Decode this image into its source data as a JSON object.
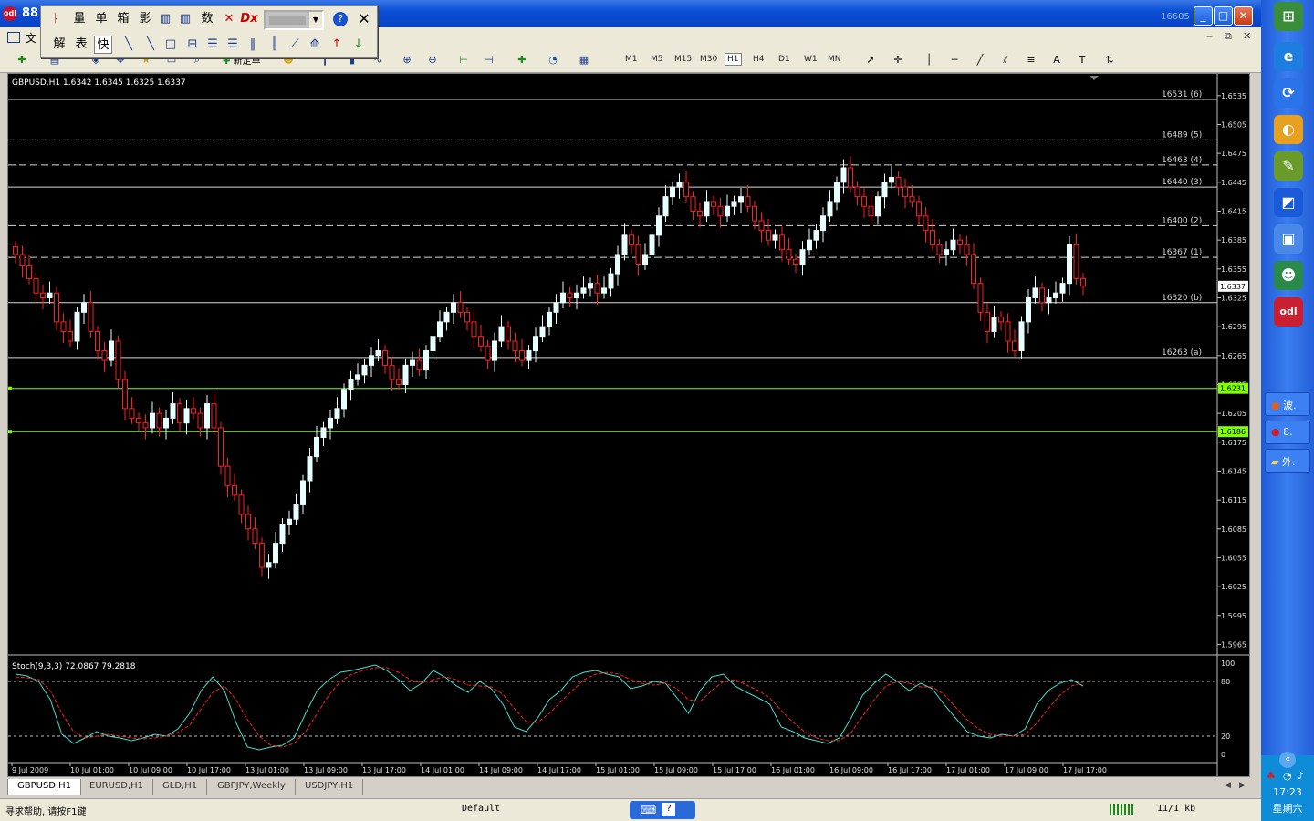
{
  "window": {
    "title": "88",
    "right_label": "16605"
  },
  "menu": {
    "first_label": "文"
  },
  "float_toolbar": {
    "row1": [
      "量",
      "单",
      "箱",
      "影",
      "数"
    ],
    "row2": [
      "解",
      "表",
      "快"
    ]
  },
  "toolbar": {
    "new_order_label": "新定单",
    "timeframes": [
      "M1",
      "M5",
      "M15",
      "M30",
      "H1",
      "H4",
      "D1",
      "W1",
      "MN"
    ],
    "active_timeframe": "H1"
  },
  "chart": {
    "symbol_info": "GBPUSD,H1  1.6342 1.6345 1.6325 1.6337",
    "price_labels": [
      "1.6535",
      "1.6505",
      "1.6475",
      "1.6445",
      "1.6415",
      "1.6385",
      "1.6355",
      "1.6325",
      "1.6295",
      "1.6265",
      "1.6235",
      "1.6205",
      "1.6175",
      "1.6145",
      "1.6115",
      "1.6085",
      "1.6055",
      "1.6025",
      "1.5995",
      "1.5965"
    ],
    "current_price": "1.6337",
    "green_lines": [
      "1.6231",
      "1.6186"
    ],
    "levels": [
      {
        "label": "16531 (6)",
        "price": 1.6531,
        "style": "solid"
      },
      {
        "label": "16489 (5)",
        "price": 1.6489,
        "style": "dashed"
      },
      {
        "label": "16463 (4)",
        "price": 1.6463,
        "style": "dashed"
      },
      {
        "label": "16440 (3)",
        "price": 1.644,
        "style": "solid"
      },
      {
        "label": "16400 (2)",
        "price": 1.64,
        "style": "dashed"
      },
      {
        "label": "16367 (1)",
        "price": 1.6367,
        "style": "dashed"
      },
      {
        "label": "16320 (b)",
        "price": 1.632,
        "style": "solid"
      },
      {
        "label": "16263 (a)",
        "price": 1.6263,
        "style": "solid"
      }
    ],
    "time_labels": [
      "9 Jul 2009",
      "10 Jul 01:00",
      "10 Jul 09:00",
      "10 Jul 17:00",
      "13 Jul 01:00",
      "13 Jul 09:00",
      "13 Jul 17:00",
      "14 Jul 01:00",
      "14 Jul 09:00",
      "14 Jul 17:00",
      "15 Jul 01:00",
      "15 Jul 09:00",
      "15 Jul 17:00",
      "16 Jul 01:00",
      "16 Jul 09:00",
      "16 Jul 17:00",
      "17 Jul 01:00",
      "17 Jul 09:00",
      "17 Jul 17:00"
    ],
    "stoch_label": "Stoch(9,3,3) 72.0867 79.2818",
    "stoch_scale": [
      "100",
      "80",
      "20",
      "0"
    ]
  },
  "chart_data": {
    "type": "candlestick",
    "title": "GBPUSD,H1",
    "ylim": [
      1.5955,
      1.655
    ],
    "closes": [
      1.637,
      1.6358,
      1.6345,
      1.633,
      1.6325,
      1.633,
      1.63,
      1.629,
      1.628,
      1.631,
      1.632,
      1.629,
      1.627,
      1.626,
      1.628,
      1.624,
      1.621,
      1.62,
      1.6195,
      1.619,
      1.6205,
      1.619,
      1.62,
      1.6215,
      1.6195,
      1.621,
      1.6205,
      1.619,
      1.6215,
      1.619,
      1.615,
      1.613,
      1.612,
      1.61,
      1.6085,
      1.607,
      1.6045,
      1.605,
      1.607,
      1.609,
      1.6095,
      1.611,
      1.6135,
      1.616,
      1.618,
      1.619,
      1.62,
      1.621,
      1.623,
      1.624,
      1.6245,
      1.6255,
      1.6265,
      1.627,
      1.6255,
      1.624,
      1.6235,
      1.6255,
      1.626,
      1.625,
      1.627,
      1.6285,
      1.63,
      1.631,
      1.632,
      1.631,
      1.63,
      1.6285,
      1.6275,
      1.626,
      1.628,
      1.6295,
      1.628,
      1.627,
      1.626,
      1.627,
      1.6285,
      1.6295,
      1.631,
      1.632,
      1.633,
      1.6325,
      1.633,
      1.6335,
      1.634,
      1.633,
      1.6335,
      1.635,
      1.637,
      1.639,
      1.638,
      1.636,
      1.637,
      1.639,
      1.641,
      1.643,
      1.644,
      1.6445,
      1.643,
      1.6415,
      1.641,
      1.6425,
      1.642,
      1.641,
      1.642,
      1.6425,
      1.643,
      1.642,
      1.6405,
      1.6395,
      1.6385,
      1.639,
      1.6375,
      1.6365,
      1.636,
      1.6375,
      1.6385,
      1.6395,
      1.641,
      1.6425,
      1.6445,
      1.646,
      1.644,
      1.643,
      1.642,
      1.641,
      1.643,
      1.6445,
      1.645,
      1.644,
      1.643,
      1.6425,
      1.641,
      1.6395,
      1.638,
      1.637,
      1.6375,
      1.6385,
      1.638,
      1.637,
      1.634,
      1.631,
      1.629,
      1.6305,
      1.63,
      1.628,
      1.627,
      1.63,
      1.6325,
      1.6335,
      1.632,
      1.6325,
      1.633,
      1.634,
      1.638,
      1.6345,
      1.6337
    ],
    "stoch_k": [
      88,
      86,
      80,
      60,
      22,
      12,
      18,
      25,
      20,
      18,
      15,
      18,
      22,
      20,
      28,
      45,
      70,
      85,
      70,
      35,
      8,
      5,
      8,
      10,
      18,
      45,
      70,
      82,
      90,
      92,
      95,
      98,
      92,
      82,
      70,
      78,
      92,
      85,
      75,
      68,
      80,
      72,
      55,
      30,
      25,
      40,
      60,
      70,
      85,
      90,
      92,
      88,
      85,
      72,
      75,
      80,
      78,
      62,
      45,
      70,
      85,
      88,
      75,
      68,
      62,
      55,
      30,
      25,
      18,
      15,
      12,
      18,
      40,
      65,
      78,
      88,
      80,
      70,
      78,
      72,
      55,
      40,
      25,
      20,
      18,
      22,
      20,
      28,
      55,
      70,
      78,
      82,
      75
    ],
    "stoch_d": [
      85,
      84,
      82,
      70,
      45,
      25,
      18,
      20,
      22,
      20,
      18,
      17,
      18,
      20,
      24,
      32,
      50,
      68,
      75,
      60,
      38,
      20,
      10,
      8,
      12,
      25,
      45,
      65,
      80,
      88,
      92,
      95,
      95,
      90,
      82,
      78,
      82,
      85,
      82,
      76,
      75,
      74,
      66,
      50,
      36,
      35,
      45,
      58,
      70,
      82,
      88,
      90,
      88,
      82,
      78,
      76,
      78,
      72,
      60,
      58,
      70,
      80,
      82,
      76,
      70,
      62,
      48,
      35,
      25,
      18,
      15,
      15,
      24,
      42,
      60,
      75,
      80,
      78,
      74,
      74,
      66,
      52,
      38,
      28,
      22,
      20,
      20,
      22,
      34,
      50,
      65,
      75,
      79
    ]
  },
  "tabs": [
    "GBPUSD,H1",
    "EURUSD,H1",
    "GLD,H1",
    "GBPJPY,Weekly",
    "USDJPY,H1"
  ],
  "status": {
    "help": "寻求帮助, 请按F1键",
    "profile": "Default",
    "traffic": "11/1 kb"
  },
  "taskbar": {
    "items": [
      "波.",
      "8.",
      "外."
    ],
    "time": "17:23",
    "day": "星期六"
  },
  "colors": {
    "bull": "#e8ffff",
    "bear": "#ff1f1f",
    "level": "#d8d8d8",
    "green": "#7fff00",
    "stoch_k": "#40e0d0",
    "stoch_d": "#ff2020"
  }
}
